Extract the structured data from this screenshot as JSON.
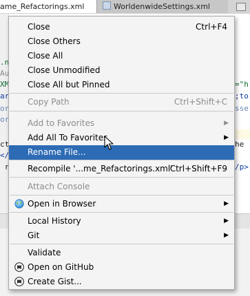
{
  "editor": {
    "tabs": [
      {
        "label": "ame_Refactorings.xml"
      },
      {
        "label": "WorldenwideSettings.xml"
      }
    ],
    "code_lines": [
      {
        "text": ".ne",
        "color": "#0c6b2e"
      },
      {
        "text": "Au",
        "color": "#8a8a8a"
      },
      {
        "text": "XM",
        "color": "#0c6b2e"
      },
      {
        "text": "ar",
        "color": "#0e3a9e"
      },
      {
        "text": "or",
        "color": "#6a87b8"
      },
      {
        "text": "or",
        "color": "#6a87b8"
      },
      {
        "text": "cte",
        "color": "#222222"
      },
      {
        "text": "</",
        "color": "#0e3a9e"
      },
      {
        "text": " re",
        "color": "#222222"
      },
      {
        "text": "=\"h",
        "color": "#0c6b2e"
      },
      {
        "text": ";to",
        "color": "#0e3a9e"
      },
      {
        "text": "sse",
        "color": "#6a87b8"
      },
      {
        "text": "he",
        "color": "#222222"
      },
      {
        "text": "/p>",
        "color": "#0e3a9e"
      }
    ]
  },
  "context_menu": {
    "items": [
      {
        "label": "Close",
        "shortcut": "Ctrl+F4"
      },
      {
        "label": "Close Others"
      },
      {
        "label": "Close All"
      },
      {
        "label": "Close Unmodified"
      },
      {
        "label": "Close All but Pinned"
      },
      {
        "label": "Copy Path",
        "shortcut": "Ctrl+Shift+C"
      },
      {
        "label": "Add to Favorites",
        "submenu": "▶"
      },
      {
        "label": "Add All To Favorites",
        "submenu": "▶"
      },
      {
        "label": "Rename File..."
      },
      {
        "label": "Recompile '...me_Refactorings.xml'",
        "shortcut": "Ctrl+Shift+F9"
      },
      {
        "label": "Attach Console"
      },
      {
        "label": "Open in Browser",
        "submenu": "▶",
        "icon": "browser-globe-icon"
      },
      {
        "label": "Local History",
        "submenu": "▶"
      },
      {
        "label": "Git",
        "submenu": "▶"
      },
      {
        "label": "Validate"
      },
      {
        "label": "Open on GitHub",
        "icon": "github-octocat-icon"
      },
      {
        "label": "Create Gist...",
        "icon": "github-octocat-icon"
      }
    ],
    "selected_item": "Rename File...",
    "colors": {
      "selection": "#2d6bb5",
      "disabled_text": "#8c8c8c",
      "background": "#f4f4f4"
    }
  }
}
